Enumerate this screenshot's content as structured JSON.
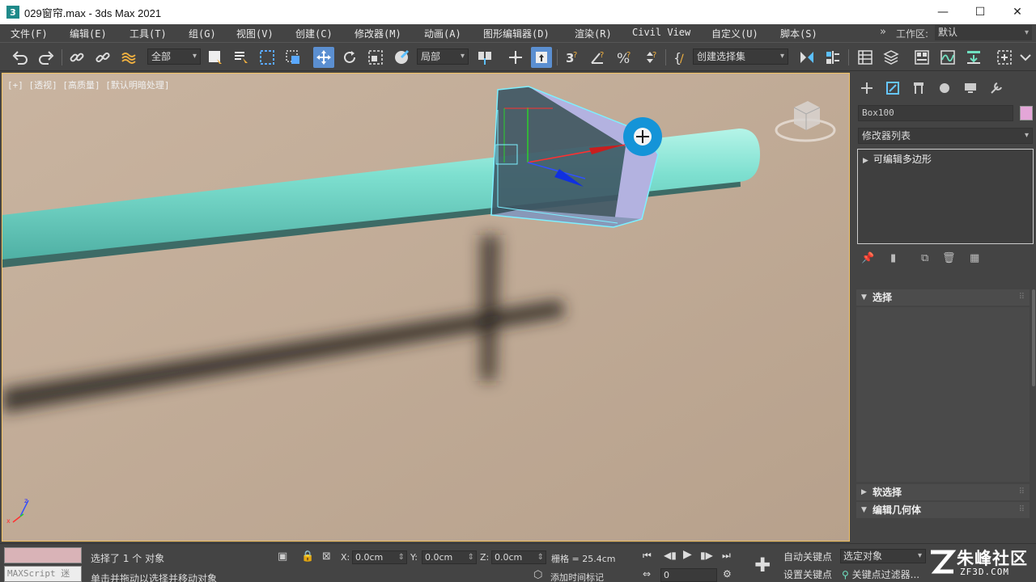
{
  "window": {
    "title": "029窗帘.max - 3ds Max 2021",
    "app_icon": "3",
    "minimize": "—",
    "maximize": "☐",
    "close": "✕"
  },
  "menu": {
    "items": [
      "文件(F)",
      "编辑(E)",
      "工具(T)",
      "组(G)",
      "视图(V)",
      "创建(C)",
      "修改器(M)",
      "动画(A)",
      "图形编辑器(D)",
      "渲染(R)",
      "Civil View",
      "自定义(U)",
      "脚本(S)"
    ],
    "overflow": "»",
    "workspace_label": "工作区:",
    "workspace_value": "默认"
  },
  "toolbar": {
    "selection_filter": "全部",
    "coord_system": "局部",
    "named_selection": "创建选择集"
  },
  "viewport": {
    "label": "[+] [透视] [高质量] [默认明暗处理]",
    "bg_color": "#bda995"
  },
  "command_panel": {
    "object_name": "Box100",
    "object_color": "#e4a6d8",
    "modifier_list": "修改器列表",
    "stack_item": "可编辑多边形",
    "rollout_selection": "选择",
    "rollout_soft": "软选择",
    "rollout_geometry": "编辑几何体"
  },
  "status": {
    "maxscript": "MAXScript 迷",
    "selected": "选择了 1 个 对象",
    "prompt": "单击并拖动以选择并移动对象",
    "x_label": "X:",
    "x_value": "0.0cm",
    "y_label": "Y:",
    "y_value": "0.0cm",
    "z_label": "Z:",
    "z_value": "0.0cm",
    "grid": "栅格 = 25.4cm",
    "add_time_tag": "添加时间标记",
    "frame": "0",
    "auto_key": "自动关键点",
    "set_key": "设置关键点",
    "selected_object": "选定对象",
    "key_filters": "关键点过滤器..."
  },
  "watermark": {
    "brand": "朱峰社区",
    "url": "ZF3D.COM"
  }
}
